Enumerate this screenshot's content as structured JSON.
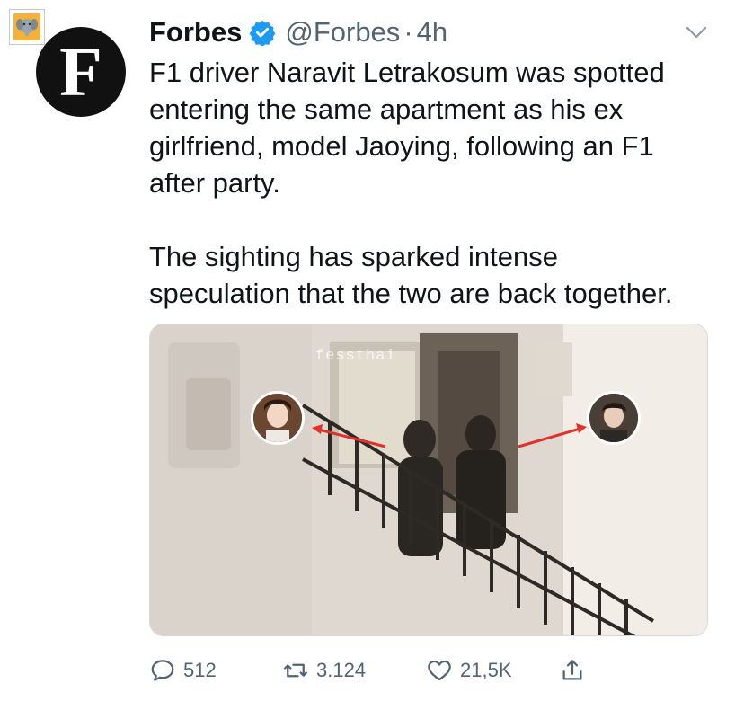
{
  "tweet": {
    "author_name": "Forbes",
    "handle": "@Forbes",
    "separator": "·",
    "time": "4h",
    "avatar_letter": "F",
    "paragraph_1": "F1 driver Naravit Letrakosum was spotted\nentering the same apartment as his ex\ngirlfriend, model Jaoying, following an F1\nafter party.",
    "paragraph_2": "The sighting has sparked intense\nspeculation that the two are back together.",
    "media": {
      "watermark": "fessthai"
    }
  },
  "actions": {
    "reply_count": "512",
    "retweet_count": "3.124",
    "like_count": "21,5K"
  },
  "icons": {
    "corner": "elephant-badge-icon",
    "verified": "verified-badge-icon",
    "menu": "chevron-down-icon",
    "reply": "reply-icon",
    "retweet": "retweet-icon",
    "like": "heart-icon",
    "share": "share-icon"
  },
  "colors": {
    "verified_blue": "#1d9bf0",
    "secondary_text": "#536471",
    "primary_text": "#0f1419",
    "arrow_red": "#e0322a"
  }
}
